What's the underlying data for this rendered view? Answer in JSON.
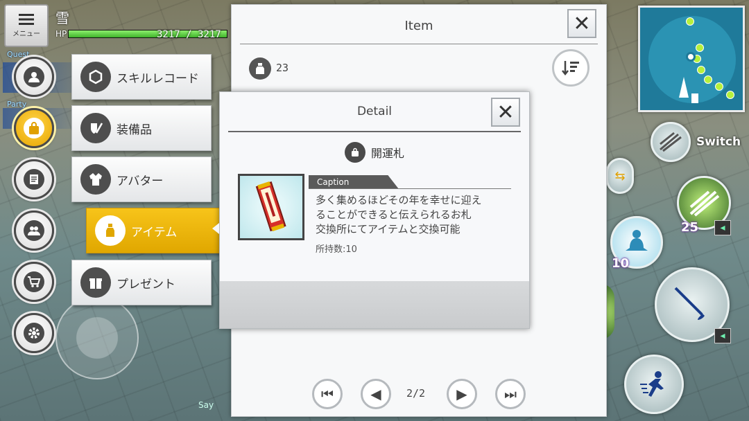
{
  "hud": {
    "menu_label": "メニュー",
    "player_name": "雪",
    "hp_label": "HP",
    "hp_text": "3217 / 3217",
    "hp_fraction": 1.0,
    "quest_tag": "Quest",
    "party_tag": "Party",
    "say_label": "Say"
  },
  "side_circles": [
    {
      "name": "profile",
      "icon": "person-icon",
      "glyph": "👤",
      "active": false
    },
    {
      "name": "bag",
      "icon": "bag-icon",
      "glyph": "👜",
      "active": true
    },
    {
      "name": "notes",
      "icon": "notes-icon",
      "glyph": "📝",
      "active": false
    },
    {
      "name": "friends",
      "icon": "friends-icon",
      "glyph": "👥",
      "active": false
    },
    {
      "name": "shop",
      "icon": "cart-icon",
      "glyph": "🛒",
      "active": false
    },
    {
      "name": "settings",
      "icon": "gear-icon",
      "glyph": "⚙",
      "active": false
    }
  ],
  "submenu": {
    "skill_record": "スキルレコード",
    "equipment": "装備品",
    "avatar": "アバター",
    "item": "アイテム",
    "present": "プレゼント"
  },
  "item_window": {
    "title": "Item",
    "count": "23",
    "page": "2/2"
  },
  "detail": {
    "title": "Detail",
    "item_name": "開運札",
    "caption_label": "Caption",
    "caption_lines": [
      "多く集めるほどその年を幸せに迎え",
      "ることができると伝えられるお札",
      "交換所にてアイテムと交換可能"
    ],
    "owned": "所持数:10"
  },
  "combat": {
    "switch_label": "Switch",
    "skill_level": "25",
    "buff_level": "10"
  },
  "colors": {
    "accent": "#f0b400",
    "hp": "#5ccf3c",
    "minimap": "#1f7a9a"
  }
}
